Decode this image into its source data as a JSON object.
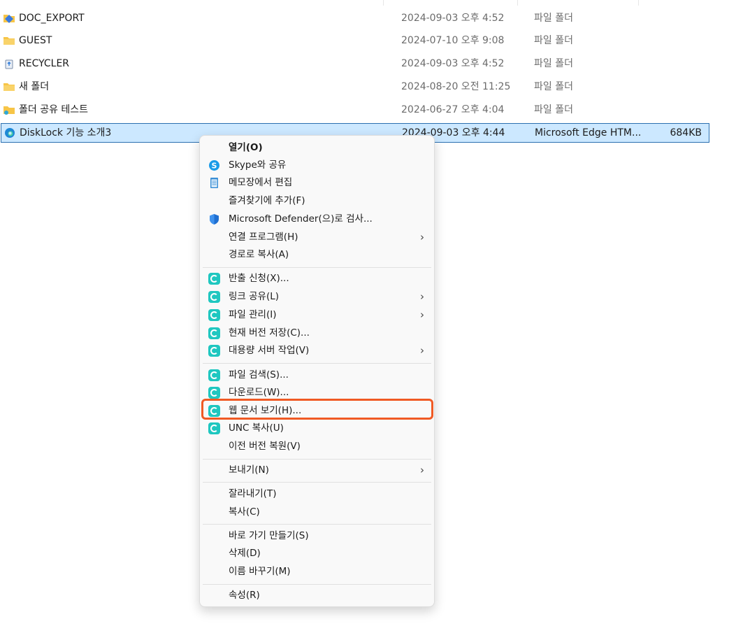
{
  "files": [
    {
      "name": "DOC_EXPORT",
      "date": "2024-09-03 오후 4:52",
      "type": "파일 폴더",
      "size": "",
      "icon": "shared-folder-icon"
    },
    {
      "name": "GUEST",
      "date": "2024-07-10 오후 9:08",
      "type": "파일 폴더",
      "size": "",
      "icon": "folder-icon"
    },
    {
      "name": "RECYCLER",
      "date": "2024-09-03 오후 4:52",
      "type": "파일 폴더",
      "size": "",
      "icon": "recycle-bin-icon"
    },
    {
      "name": "새 폴더",
      "date": "2024-08-20 오전 11:25",
      "type": "파일 폴더",
      "size": "",
      "icon": "folder-icon"
    },
    {
      "name": "폴더 공유 테스트",
      "date": "2024-06-27 오후 4:04",
      "type": "파일 폴더",
      "size": "",
      "icon": "shared-folder-icon"
    },
    {
      "name": "DiskLock 기능 소개3",
      "date": "2024-09-03 오후 4:44",
      "type": "Microsoft Edge HTM...",
      "size": "684KB",
      "icon": "edge-icon"
    }
  ],
  "context_menu": {
    "items": {
      "open": "열기(O)",
      "skype_share": "Skype와 공유",
      "edit_notepad": "메모장에서 편집",
      "add_favorites": "즐겨찾기에 추가(F)",
      "defender_scan": "Microsoft Defender(으)로 검사...",
      "open_with": "연결 프로그램(H)",
      "copy_path": "경로로 복사(A)",
      "checkout_request": "반출 신청(X)...",
      "link_share": "링크 공유(L)",
      "file_manage": "파일 관리(I)",
      "save_current_version": "현재 버전 저장(C)...",
      "large_server_task": "대용량 서버 작업(V)",
      "file_search": "파일 검색(S)...",
      "download": "다운로드(W)...",
      "view_web_document": "웹 문서 보기(H)...",
      "unc_copy": "UNC 복사(U)",
      "restore_previous": "이전 버전 복원(V)",
      "send_to": "보내기(N)",
      "cut": "잘라내기(T)",
      "copy": "복사(C)",
      "create_shortcut": "바로 가기 만들기(S)",
      "delete": "삭제(D)",
      "rename": "이름 바꾸기(M)",
      "properties": "속성(R)"
    },
    "submenu_glyph": "›"
  },
  "colors": {
    "selection_bg": "#cce8ff",
    "selection_border": "#2b6fb0",
    "app_icon": "#1fc7c0",
    "highlight": "#f05a24"
  }
}
